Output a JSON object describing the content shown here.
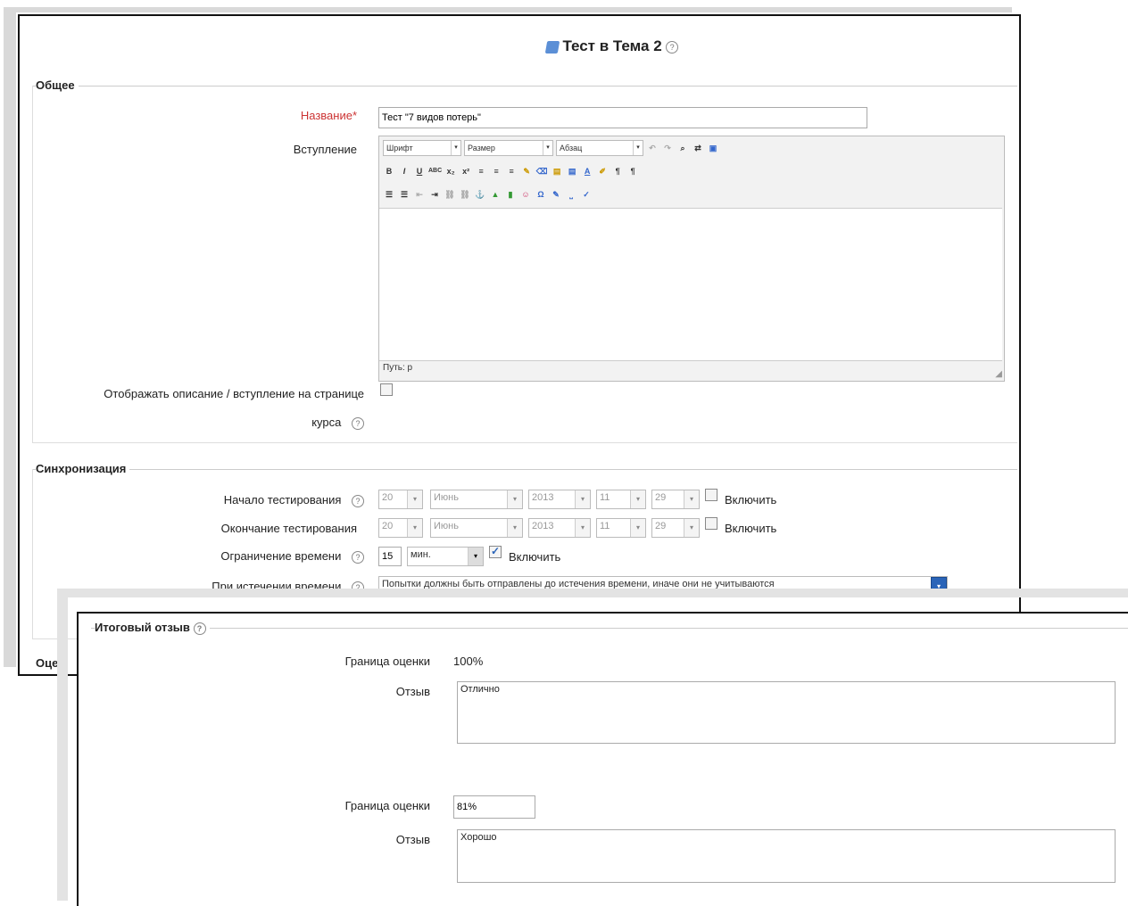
{
  "main_window": {
    "title": "Тест в Тема 2",
    "sections": {
      "general": "Общее",
      "timing": "Синхронизация",
      "grade_partial": "Оцен"
    },
    "name_label": "Название*",
    "name_value": "Тест \"7 видов потерь\"",
    "intro_label": "Вступление",
    "editor": {
      "font_select": "Шрифт",
      "size_select": "Размер",
      "para_select": "Абзац",
      "row2": [
        "B",
        "I",
        "U",
        "ABC",
        "x₂",
        "x²"
      ],
      "path": "Путь: p"
    },
    "show_description_label_line1": "Отображать описание / вступление на странице",
    "show_description_label_line2": "курса",
    "timing": {
      "open_label": "Начало тестирования",
      "close_label": "Окончание тестирования",
      "limit_label": "Ограничение времени",
      "expire_label": "При истечении времени",
      "day": "20",
      "month": "Июнь",
      "year": "2013",
      "hour": "11",
      "minute": "29",
      "enable": "Включить",
      "limit_value": "15",
      "limit_unit": "мин.",
      "expire_value": "Попытки должны быть отправлены до истечения времени, иначе они не учитываются"
    }
  },
  "feedback_window": {
    "legend": "Итоговый отзыв",
    "boundary_label": "Граница оценки",
    "boundary_1": "100%",
    "feedback_label": "Отзыв",
    "feedback_1": "Отлично",
    "boundary_2": "81%",
    "feedback_2": "Хорошо"
  }
}
